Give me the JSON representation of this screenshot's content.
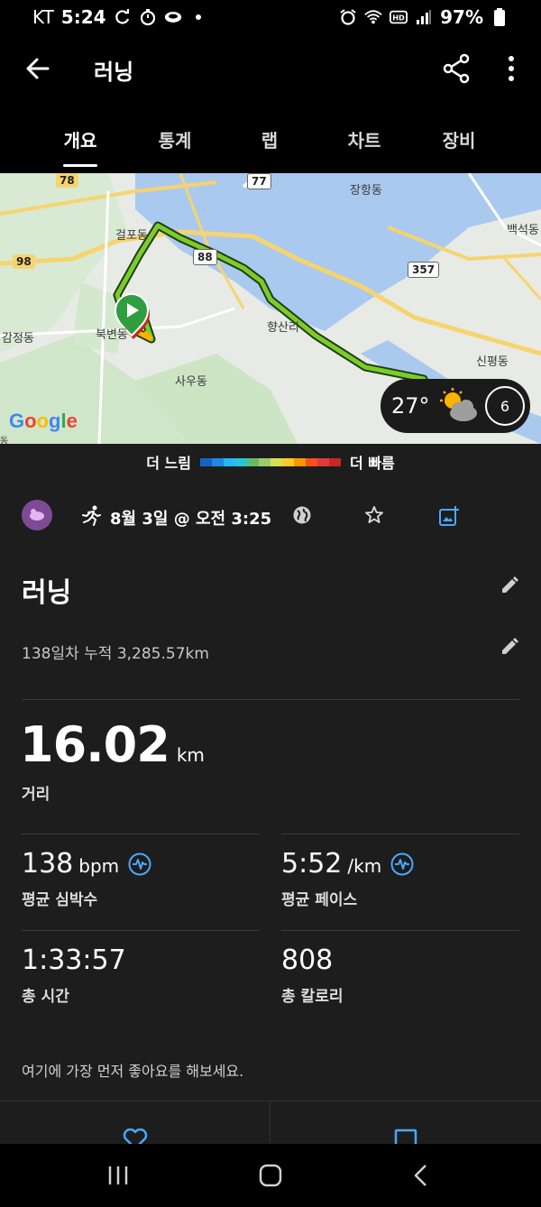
{
  "status_bar": {
    "carrier": "KT",
    "time": "5:24",
    "battery": "97%",
    "icons": [
      "sync-icon",
      "timer-icon",
      "samsung-icon",
      "dot-icon",
      "alarm-icon",
      "wifi-icon",
      "hd-icon",
      "signal-icon",
      "battery-icon"
    ]
  },
  "app_bar": {
    "title": "러닝",
    "back_icon": "arrow-left-icon",
    "share_icon": "share-icon",
    "more_icon": "more-vertical-icon"
  },
  "tabs": [
    {
      "label": "개요",
      "active": true
    },
    {
      "label": "통계",
      "active": false
    },
    {
      "label": "랩",
      "active": false
    },
    {
      "label": "차트",
      "active": false
    },
    {
      "label": "장비",
      "active": false
    }
  ],
  "map": {
    "place_labels": [
      "장항동",
      "백석동",
      "걸포동",
      "향산리",
      "감정동",
      "북변동",
      "사우동",
      "신평동",
      "동"
    ],
    "road_shields": [
      "78",
      "98",
      "88",
      "357",
      "77"
    ],
    "attribution": "Google",
    "weather": {
      "temperature": "27°",
      "icon": "partly-cloudy-icon",
      "uv_index": "6"
    }
  },
  "legend": {
    "slow_label": "더 느림",
    "fast_label": "더 빠름",
    "colors": [
      "#1565c0",
      "#1e88e5",
      "#29b6f6",
      "#26c6da",
      "#66bb6a",
      "#9ccc65",
      "#d4e157",
      "#ffca28",
      "#ff9800",
      "#f4511e",
      "#e53935",
      "#c62828"
    ]
  },
  "activity": {
    "date_time": "8월 3일 @ 오전 3:25",
    "title": "러닝",
    "cumulative": "138일차 누적 3,285.57km",
    "distance": {
      "value": "16.02",
      "unit": "km",
      "label": "거리"
    },
    "heart_rate": {
      "value": "138",
      "unit": "bpm",
      "label": "평균 심박수"
    },
    "pace": {
      "value": "5:52",
      "unit": "/km",
      "label": "평균 페이스"
    },
    "duration": {
      "value": "1:33:57",
      "label": "총 시간"
    },
    "calories": {
      "value": "808",
      "label": "총 칼로리"
    },
    "kudos_prompt": "여기에 가장 먼저 좋아요를 해보세요."
  },
  "colors": {
    "background": "#000000",
    "card": "#1d1d1d",
    "accent_blue": "#4aa8ff",
    "route_green": "#7ccc29"
  }
}
